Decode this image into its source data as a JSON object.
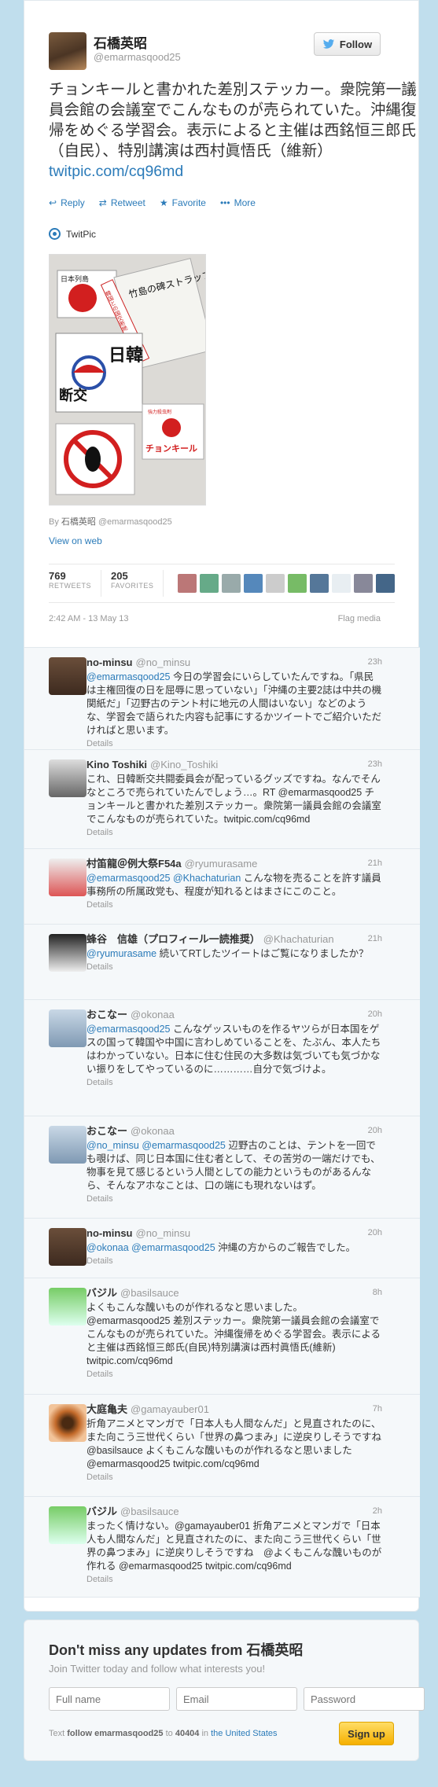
{
  "tweet": {
    "name": "石橋英昭",
    "handle": "@emarmasqood25",
    "follow_label": "Follow",
    "text": "チョンキールと書かれた差別ステッカー。衆院第一議員会館の会議室でこんなものが売られていた。沖縄復帰をめぐる学習会。表示によると主催は西銘恒三郎氏（自民）、特別講演は西村眞悟氏（維新）",
    "link": "twitpic.com/cq96md",
    "actions": {
      "reply": "Reply",
      "retweet": "Retweet",
      "favorite": "Favorite",
      "more": "More"
    },
    "media_source": "TwitPic",
    "photo_texts": {
      "s1": "日本列島",
      "s2": "竹島の碑ストラップ",
      "s3": "韓国との国交断絶",
      "s4": "日韓",
      "s5": "断交",
      "s6": "強力殺虫剤",
      "s7": "チョンキール"
    },
    "byline_prefix": "By",
    "byline_name": "石橋英昭",
    "byline_handle": "@emarmasqood25",
    "view_on_web": "View on web",
    "retweets": "769",
    "retweets_label": "RETWEETS",
    "favorites": "205",
    "favorites_label": "FAVORITES",
    "timestamp": "2:42 AM - 13 May 13",
    "flag": "Flag media"
  },
  "replies": [
    {
      "name": "no-minsu",
      "handle": "@no_minsu",
      "time": "23h",
      "mention": "@emarmasqood25",
      "text": " 今日の学習会にいらしていたんですね。「県民は主権回復の日を屈辱に思っていない」「沖縄の主要2誌は中共の機関紙だ」「辺野古のテント村に地元の人間はいない」などのような、学習会で語られた内容も記事にするかツイートでご紹介いただければと思います。",
      "details": "Details"
    },
    {
      "name": "Kino Toshiki",
      "handle": "@Kino_Toshiki",
      "time": "23h",
      "mention": "",
      "text": "これ、日韓断交共闘委員会が配っているグッズですね。なんでそんなところで売られていたんでしょう…。RT @emarmasqood25 チョンキールと書かれた差別ステッカー。衆院第一議員会館の会議室でこんなものが売られていた。twitpic.com/cq96md",
      "details": "Details"
    },
    {
      "name": "村笛龍＠例大祭F54a",
      "handle": "@ryumurasame",
      "time": "21h",
      "mention": "@emarmasqood25 @Khachaturian",
      "text": " こんな物を売ることを許す議員事務所の所属政党も、程度が知れるとはまさにこのこと。",
      "details": "Details"
    },
    {
      "name": "蜂谷　信雄（プロフィール一読推奨）",
      "handle": "@Khachaturian",
      "time": "21h",
      "mention": "@ryumurasame",
      "text": " 続いてRTしたツイートはご覧になりましたか？",
      "details": "Details"
    },
    {
      "name": "おこなー",
      "handle": "@okonaa",
      "time": "20h",
      "mention": "@emarmasqood25",
      "text": " こんなゲッスいものを作るヤツらが日本国をゲスの国って韓国や中国に言わしめていることを、たぶん、本人たちはわかっていない。日本に住む住民の大多数は気づいても気づかない振りをしてやっているのに…………自分で気づけよ。",
      "details": "Details"
    },
    {
      "name": "おこなー",
      "handle": "@okonaa",
      "time": "20h",
      "mention": "@no_minsu @emarmasqood25",
      "text": " 辺野古のことは、テントを一回でも覗けば、同じ日本国に住む者として、その苦労の一端だけでも、物事を見て感じるという人間としての能力というものがあるんなら、そんなアホなことは、口の端にも現れないはず。",
      "details": "Details"
    },
    {
      "name": "no-minsu",
      "handle": "@no_minsu",
      "time": "20h",
      "mention": "@okonaa @emarmasqood25",
      "text": " 沖縄の方からのご報告でした。",
      "details": "Details"
    },
    {
      "name": "バジル",
      "handle": "@basilsauce",
      "time": "8h",
      "mention": "",
      "text": "よくもこんな醜いものが作れるなと思いました。@emarmasqood25 差別ステッカー。衆院第一議員会館の会議室でこんなものが売られていた。沖縄復帰をめぐる学習会。表示によると主催は西銘恒三郎氏(自民)特別講演は西村眞悟氏(維新) twitpic.com/cq96md",
      "details": "Details"
    },
    {
      "name": "大庭亀夫",
      "handle": "@gamayauber01",
      "time": "7h",
      "mention": "",
      "text": "折角アニメとマンガで「日本人も人間なんだ」と見直されたのに、また向こう三世代くらい「世界の鼻つまみ」に逆戻りしそうですね　@basilsauce よくもこんな醜いものが作れるなと思いました　@emarmasqood25 twitpic.com/cq96md",
      "details": "Details"
    },
    {
      "name": "バジル",
      "handle": "@basilsauce",
      "time": "2h",
      "mention": "",
      "text": "まったく情けない。@gamayauber01 折角アニメとマンガで「日本人も人間なんだ」と見直されたのに、また向こう三世代くらい「世界の鼻つまみ」に逆戻りしそうですね　@よくもこんな醜いものが作れる @emarmasqood25 twitpic.com/cq96md",
      "details": "Details"
    }
  ],
  "signup": {
    "title": "Don't miss any updates from 石橋英昭",
    "subtitle": "Join Twitter today and follow what interests you!",
    "name_ph": "Full name",
    "email_ph": "Email",
    "password_ph": "Password",
    "foot_text": "Text",
    "foot_cmd": "follow emarmasqood25",
    "foot_to": "to",
    "foot_num": "40404",
    "foot_in": "in",
    "foot_loc": "the United States",
    "button": "Sign up"
  },
  "colors": {
    "link": "#2b7bb9",
    "bg": "#c0deed",
    "signup": "#f5b000"
  }
}
